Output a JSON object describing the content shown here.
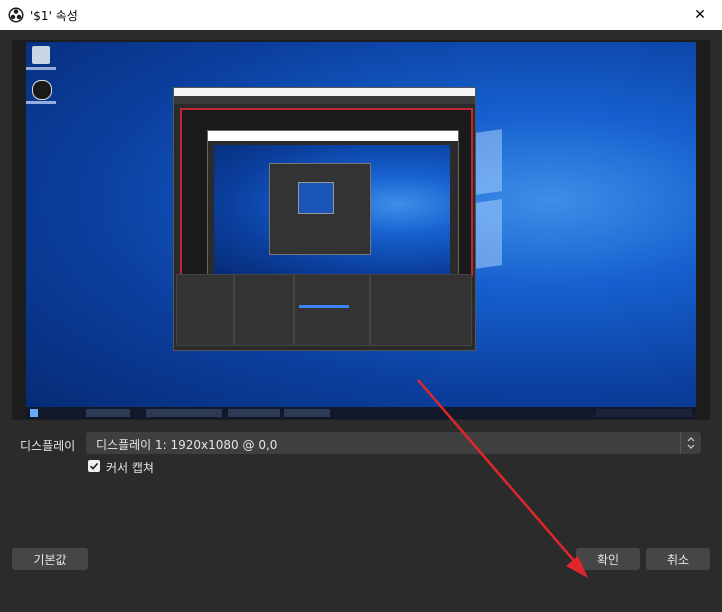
{
  "window": {
    "title": "'$1' 속성",
    "close_glyph": "✕"
  },
  "preview": {
    "source": "display-capture-preview"
  },
  "settings": {
    "display_label": "디스플레이",
    "display_value": "디스플레이 1: 1920x1080 @ 0,0",
    "capture_cursor_label": "커서 캡쳐",
    "capture_cursor_checked": true
  },
  "buttons": {
    "defaults": "기본값",
    "ok": "확인",
    "cancel": "취소"
  },
  "annotation": {
    "arrow_color": "#e0262b"
  }
}
